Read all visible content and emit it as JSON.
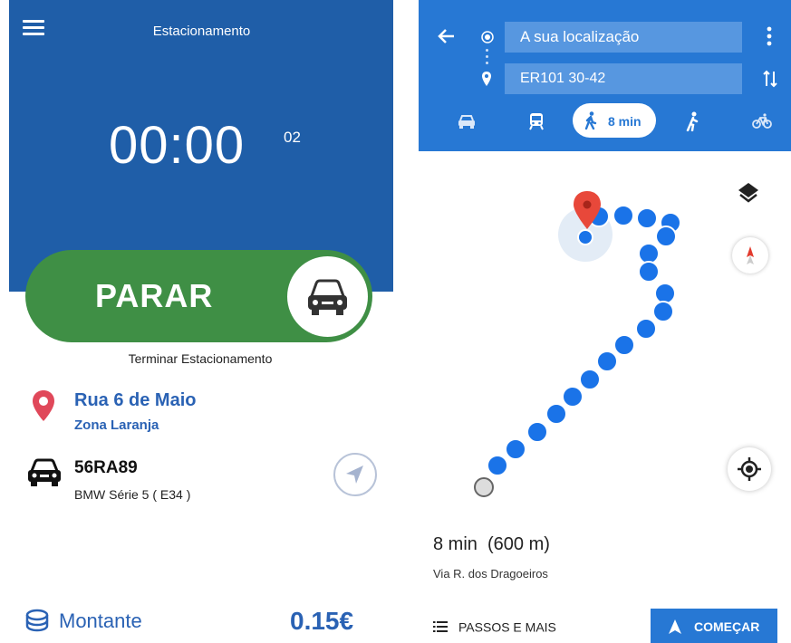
{
  "parking": {
    "title": "Estacionamento",
    "timer_main": "00:00",
    "timer_seconds": "02",
    "stop_label": "PARAR",
    "stop_caption": "Terminar Estacionamento",
    "street": "Rua 6 de Maio",
    "zone": "Zona Laranja",
    "plate": "56RA89",
    "car_model": "BMW Série 5 ( E34 )",
    "amount_label": "Montante",
    "amount_value": "0.15€"
  },
  "directions": {
    "origin": "A sua localização",
    "destination": "ER101 30-42",
    "walk_time": "8 min",
    "duration": "8 min  (600 m)",
    "via": "Via R. dos Dragoeiros",
    "steps_label": "PASSOS E MAIS",
    "start_label": "COMEÇAR"
  },
  "colors": {
    "parking_header": "#1f5ea8",
    "stop_green": "#3f8f45",
    "accent_blue": "#2a62b4",
    "maps_blue": "#2778d4",
    "route_blue": "#1a73e8",
    "pin_red": "#e8483a"
  },
  "icons": [
    "menu-icon",
    "car-icon",
    "map-pin-icon",
    "navigation-arrow-icon",
    "coins-icon",
    "back-arrow-icon",
    "more-vert-icon",
    "swap-icon",
    "transit-icon",
    "walk-icon",
    "ride-icon",
    "bike-icon",
    "layers-icon",
    "compass-icon",
    "my-location-icon",
    "list-icon",
    "navigation-icon"
  ]
}
